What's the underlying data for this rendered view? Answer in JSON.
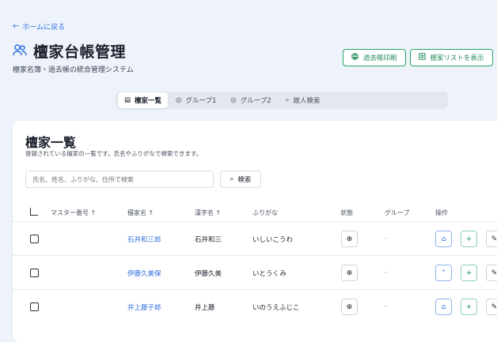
{
  "back_link": {
    "label": "ホームに戻る",
    "icon": "arrow-left-icon"
  },
  "page": {
    "title": "檀家台帳管理",
    "title_icon": "users-icon",
    "subtitle": "檀家名簿・過去帳の統合管理システム"
  },
  "header_buttons": [
    {
      "label": "過去帳印刷",
      "icon": "printer-icon"
    },
    {
      "label": "檀家リストを表示",
      "icon": "list-icon"
    }
  ],
  "tabs": [
    {
      "label": "檀家一覧",
      "icon": "list-icon",
      "active": true
    },
    {
      "label": "グループ1",
      "icon": "circle-icon",
      "active": false
    },
    {
      "label": "グループ2",
      "icon": "circle-icon",
      "active": false
    },
    {
      "label": "故人検索",
      "icon": "search-icon",
      "active": false
    }
  ],
  "card": {
    "title": "檀家一覧",
    "description": "登録されている檀家の一覧です。氏名やふりがなで検索できます。",
    "search": {
      "placeholder": "氏名、姓名、ふりがな、住所で検索",
      "value": ""
    },
    "search_button": "検索"
  },
  "table": {
    "headers": [
      "マスター番号 ↑",
      "檀家名 ↑",
      "漢字名 ↑",
      "ふりがな",
      "状態",
      "グループ",
      "操作"
    ],
    "rows": [
      {
        "name": "石井和三郎",
        "kanji": "石井和三",
        "furigana": "いしいこうわ",
        "group": "-"
      },
      {
        "name": "伊藤久美保",
        "kanji": "伊藤久美",
        "furigana": "いとうくみ",
        "group": "-"
      },
      {
        "name": "井上藤子郎",
        "kanji": "井上藤",
        "furigana": "いのうえふじこ",
        "group": "-"
      }
    ]
  },
  "colors": {
    "accent": "#2f6fe0",
    "success": "#1f8b58",
    "background": "#eef3fb"
  }
}
